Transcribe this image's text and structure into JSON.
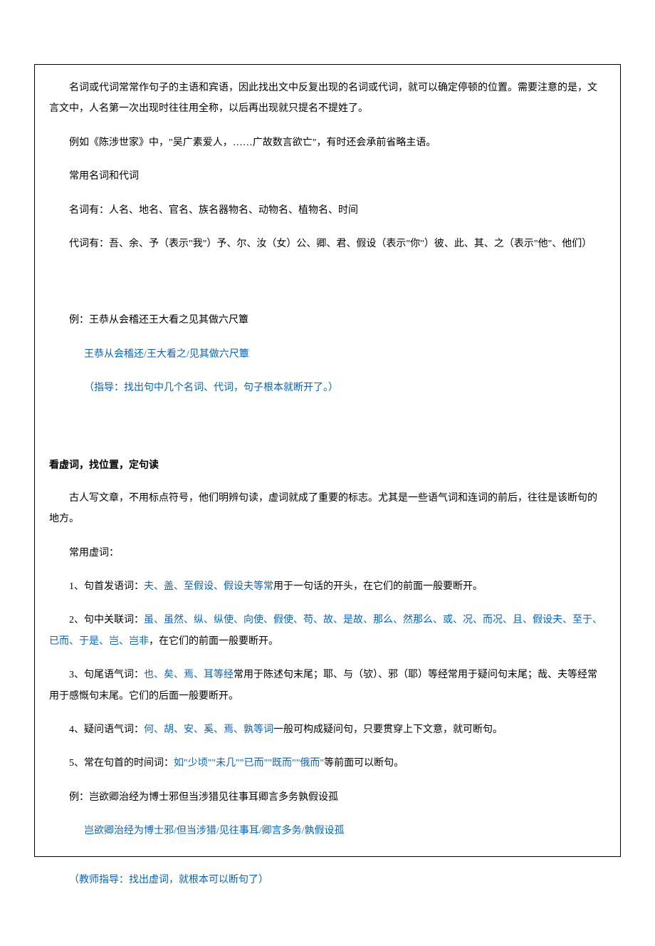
{
  "p1": "名词或代词常常作句子的主语和宾语，因此找出文中反复出现的名词或代词，就可以确定停顿的位置。需要注意的是，文言文中，人名第一次出现时往往用全称，以后再出现就只提名不提姓了。",
  "p2": "例如《陈涉世家》中，\"吴广素爱人，……广故数言欲亡\"，有时还会承前省略主语。",
  "p3": "常用名词和代词",
  "p4": "名词有：人名、地名、官名、族名器物名、动物名、植物名、时间",
  "p5": "代词有：吾、余、予（表示\"我\"）予、尔、汝（女）公、卿、君、假设（表示\"你\"）彼、此、其、之（表示\"他\"、他们）",
  "p6": "例：王恭从会稽还王大看之见其做六尺簟",
  "p7": "王恭从会稽还/王大看之/见其做六尺簟",
  "p8": "（指导：找出句中几个名词、代词，句子根本就断开了。）",
  "h2": "看虚词，找位置，定句读",
  "q1": "古人写文章，不用标点符号，他们明辨句读，虚词就成了重要的标志。尤其是一些语气词和连词的前后，往往是该断句的地方。",
  "q2": "常用虚词：",
  "q3a": "1、句首发语词：",
  "q3b": "夫、盖、至假设、假设夫等常",
  "q3c": "用于一句话的开头，在它们的前面一般要断开。",
  "q4a": "2、句中关联词：",
  "q4b": "虽、虽然、纵、纵使、向使、假使、苟、故、是故、那么、然那么、或、况、而况、且、假设夫、至于、已而、于是、岂、岂非",
  "q4c": "，在它们的前面一般要断开。",
  "q5a": "3、句尾语气词：",
  "q5b": "也、矣、焉、耳等经",
  "q5c": "常用于陈述句末尾；耶、与（欤）、邪（耶）等经常用于疑问句末尾；哉、夫等经常用于感慨句末尾。它们的后面一般要断开。",
  "q6a": "4、疑问语气词：",
  "q6b": "何、胡、安、奚、焉、孰等词",
  "q6c": "一般可构成疑问句，只要贯穿上下文意，就可断句。",
  "q7a": "5、常在句首的时间词：",
  "q7b": "如\"少顷\"\"未几\"\"已而\"\"既而\"\"俄而\"",
  "q7c": "等前面可以断句。",
  "q8": "例：岂欲卿治经为博士邪但当涉猎见往事耳卿言多务孰假设孤",
  "q9": "岂欲卿治经为博士邪/但当涉猎/见往事耳/卿言多务/孰假设孤",
  "out": "（教师指导：找出虚词，就根本可以断句了）"
}
